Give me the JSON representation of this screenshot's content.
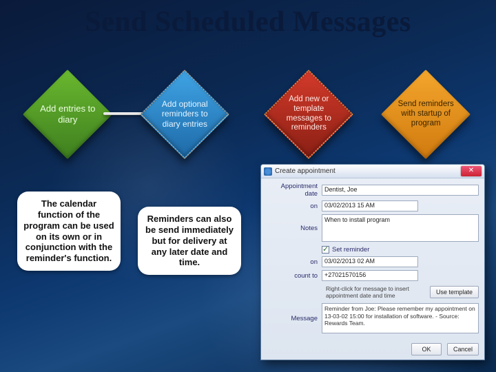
{
  "title": "Send Scheduled Messages",
  "diamonds": {
    "d1": "Add entries to diary",
    "d2": "Add optional reminders to diary entries",
    "d3": "Add new or template messages to reminders",
    "d4": "Send reminders with startup of program"
  },
  "boxes": {
    "b1": "The calendar function of the program can be used on its own or in conjunction with the reminder's function.",
    "b2": "Reminders can also be send immediately but for delivery at any later date and time."
  },
  "dialog": {
    "title": "Create appointment",
    "close": "✕",
    "labels": {
      "appt_date": "Appointment date",
      "on": "on",
      "notes": "Notes",
      "set_reminder": "Set reminder",
      "on2": "on",
      "count_to": "count to",
      "message": "Message"
    },
    "values": {
      "appt_date": "Dentist, Joe",
      "on": "03/02/2013 15 AM",
      "notes": "When to install program",
      "on2": "03/02/2013 02 AM",
      "count_to": "+27021570156"
    },
    "blurb": "Right-click for message to insert appointment date and time",
    "use_template": "Use template",
    "message_text": "Reminder from Joe: Please remember my appointment on 13-03-02 15:00 for installation of software. - Source: Rewards Team.",
    "ok": "OK",
    "cancel": "Cancel"
  }
}
